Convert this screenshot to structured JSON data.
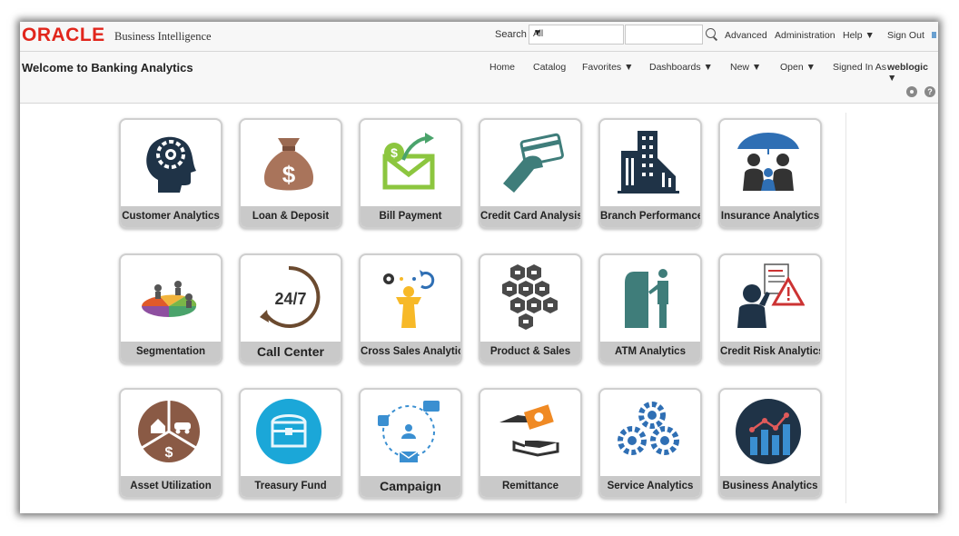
{
  "topbar": {
    "brand": "ORACLE",
    "product": "Business Intelligence",
    "search_label": "Search",
    "search_scope": "All",
    "search_value": "",
    "links": [
      "Advanced",
      "Administration",
      "Help ▼",
      "Sign Out"
    ]
  },
  "header": {
    "title": "Welcome to Banking Analytics",
    "nav": [
      "Home",
      "Catalog",
      "Favorites ▼",
      "Dashboards ▼",
      "New ▼",
      "Open ▼"
    ],
    "signed_in_label": "Signed In As",
    "user": "weblogic ▼"
  },
  "tiles": [
    {
      "label": "Customer Analytics",
      "icon": "head-gear-icon"
    },
    {
      "label": "Loan & Deposit",
      "icon": "money-bag-icon"
    },
    {
      "label": "Bill Payment",
      "icon": "envelope-dollar-icon"
    },
    {
      "label": "Credit Card Analysis",
      "icon": "hand-card-icon"
    },
    {
      "label": "Branch Performance",
      "icon": "buildings-icon"
    },
    {
      "label": "Insurance Analytics",
      "icon": "umbrella-family-icon"
    },
    {
      "label": "Segmentation",
      "icon": "pie-people-icon"
    },
    {
      "label": "Call Center",
      "icon": "24-7-icon"
    },
    {
      "label": "Cross Sales Analytics",
      "icon": "person-gears-icon"
    },
    {
      "label": "Product & Sales",
      "icon": "hexagons-icon"
    },
    {
      "label": "ATM Analytics",
      "icon": "atm-icon"
    },
    {
      "label": "Credit Risk Analytics",
      "icon": "risk-warning-icon"
    },
    {
      "label": "Asset Utilization",
      "icon": "assets-pie-icon"
    },
    {
      "label": "Treasury Fund",
      "icon": "treasure-chest-icon"
    },
    {
      "label": "Campaign",
      "icon": "social-campaign-icon"
    },
    {
      "label": "Remittance",
      "icon": "hands-money-icon"
    },
    {
      "label": "Service Analytics",
      "icon": "gears-icon"
    },
    {
      "label": "Business Analytics",
      "icon": "bar-chart-icon"
    }
  ]
}
